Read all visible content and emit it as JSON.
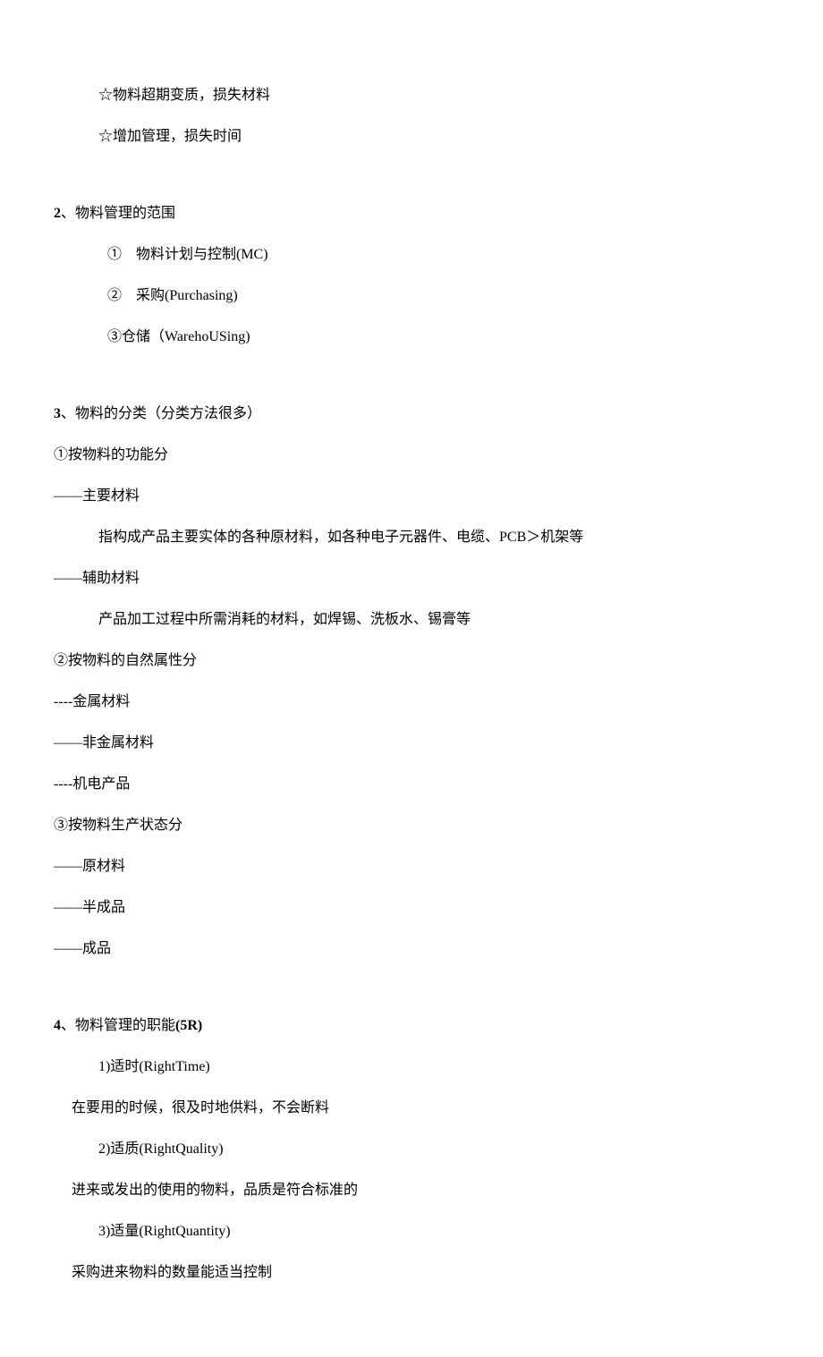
{
  "intro": {
    "line1": "☆物料超期变质，损失材料",
    "line2": "☆增加管理，损失时间"
  },
  "sec2": {
    "num": "2",
    "title": "、物料管理的范围",
    "item1": "①　物料计划与控制(MC)",
    "item2": "②　采购(Purchasing)",
    "item3": "③仓储（WarehoUSing)"
  },
  "sec3": {
    "num": "3",
    "title": "、物料的分类（分类方法很多）",
    "sub1": "①按物料的功能分",
    "sub1_a": "——主要材料",
    "sub1_a_desc": "指构成产品主要实体的各种原材料，如各种电子元器件、电缆、PCB＞机架等",
    "sub1_b": "——辅助材料",
    "sub1_b_desc": "产品加工过程中所需消耗的材料，如焊锡、洗板水、锡膏等",
    "sub2": "②按物料的自然属性分",
    "sub2_a": "----金属材料",
    "sub2_b": "——非金属材料",
    "sub2_c": "----机电产品",
    "sub3": "③按物料生产状态分",
    "sub3_a": "——原材料",
    "sub3_b": "——半成品",
    "sub3_c": "——成品"
  },
  "sec4": {
    "num": "4",
    "title_a": "、物料管理的职能",
    "title_b": "(5R)",
    "r1": "1)适时(RightTime)",
    "r1_desc": "在要用的时候，很及时地供料，不会断料",
    "r2": "2)适质(RightQuality)",
    "r2_desc": "进来或发出的使用的物料，品质是符合标准的",
    "r3": "3)适量(RightQuantity)",
    "r3_desc": "采购进来物料的数量能适当控制"
  }
}
